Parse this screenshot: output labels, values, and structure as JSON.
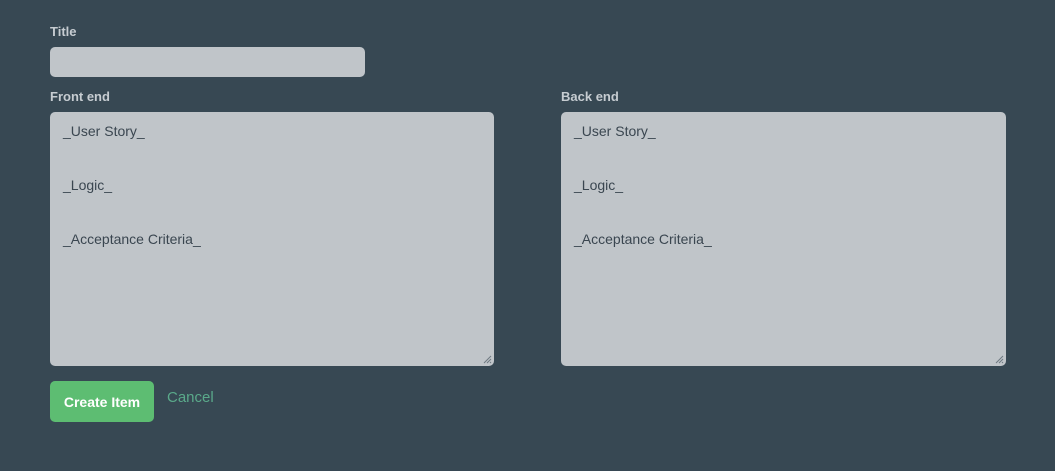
{
  "form": {
    "title_label": "Title",
    "title_value": "",
    "frontend": {
      "label": "Front end",
      "value": "_User Story_\n\n\n_Logic_\n\n\n_Acceptance Criteria_"
    },
    "backend": {
      "label": "Back end",
      "value": "_User Story_\n\n\n_Logic_\n\n\n_Acceptance Criteria_"
    },
    "create_label": "Create Item",
    "cancel_label": "Cancel"
  },
  "colors": {
    "background": "#374853",
    "field": "#c0c5c9",
    "primary_button": "#5dbd72",
    "link": "#5aa98a",
    "label": "#c6ccd1"
  }
}
